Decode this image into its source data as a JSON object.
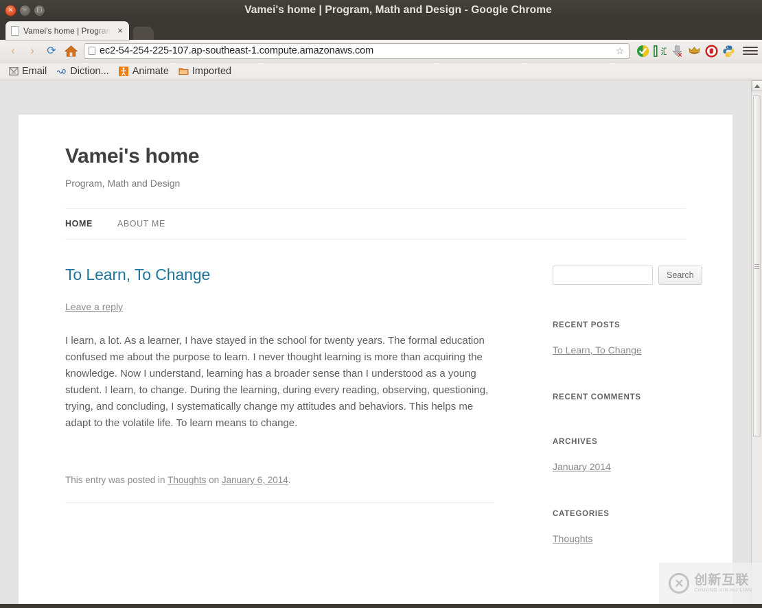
{
  "window": {
    "title": "Vamei's home | Program, Math and Design - Google Chrome",
    "controls": {
      "close": "×",
      "minimize": "−",
      "maximize": "□"
    }
  },
  "tabs": [
    {
      "title": "Vamei's home | Program, ",
      "close_label": "×",
      "icon": "page-icon"
    }
  ],
  "toolbar": {
    "back": "‹",
    "forward": "›",
    "reload": "⟳",
    "home": "⌂",
    "url": "ec2-54-254-225-107.ap-southeast-1.compute.amazonaws.com",
    "star": "☆",
    "extensions": [
      {
        "name": "wot-shield-icon",
        "glyph": "◆"
      },
      {
        "name": "youdao-dictionary-icon",
        "glyph": "汇"
      },
      {
        "name": "download-blocked-icon",
        "glyph": "↓"
      },
      {
        "name": "crown-icon",
        "glyph": "♕"
      },
      {
        "name": "adblock-icon",
        "glyph": "✋"
      },
      {
        "name": "python-icon",
        "glyph": "🐍"
      }
    ]
  },
  "bookmarks": [
    {
      "label": "Email",
      "icon": "mail-icon"
    },
    {
      "label": "Diction...",
      "icon": "dictionary-icon"
    },
    {
      "label": "Animate",
      "icon": "animate-icon"
    },
    {
      "label": "Imported",
      "icon": "folder-icon"
    }
  ],
  "site": {
    "title": "Vamei's home",
    "description": "Program, Math and Design",
    "nav": [
      {
        "label": "HOME",
        "current": true
      },
      {
        "label": "ABOUT ME",
        "current": false
      }
    ]
  },
  "post": {
    "title": "To Learn, To Change",
    "reply_link": "Leave a reply",
    "body": "I learn, a lot. As a learner, I have stayed in the school for twenty years. The formal education confused me about the purpose to learn. I never thought learning is more than acquiring the knowledge. Now I understand, learning has a broader sense than I understood as a young student. I learn, to change. During the learning, during every reading, observing, questioning, trying, and concluding, I systematically change my attitudes and behaviors. This helps me adapt to the volatile life. To learn means to change.",
    "footer_prefix": "This entry was posted in ",
    "footer_category": "Thoughts",
    "footer_middle": " on ",
    "footer_date": "January 6, 2014",
    "footer_suffix": "."
  },
  "sidebar": {
    "search": {
      "value": "",
      "placeholder": "",
      "button_label": "Search"
    },
    "widgets": [
      {
        "title": "RECENT POSTS",
        "items": [
          "To Learn, To Change"
        ]
      },
      {
        "title": "RECENT COMMENTS",
        "items": []
      },
      {
        "title": "ARCHIVES",
        "items": [
          "January 2014"
        ]
      },
      {
        "title": "CATEGORIES",
        "items": [
          "Thoughts"
        ]
      }
    ]
  },
  "watermark": {
    "logo": "✕",
    "cn": "创新互联",
    "en": "CHUANG XIN HU LIAN"
  },
  "colors": {
    "link_blue": "#21759b",
    "chrome_dark": "#3b3733",
    "page_bg": "#e4e4e4",
    "muted_text": "#8a8a8a"
  }
}
